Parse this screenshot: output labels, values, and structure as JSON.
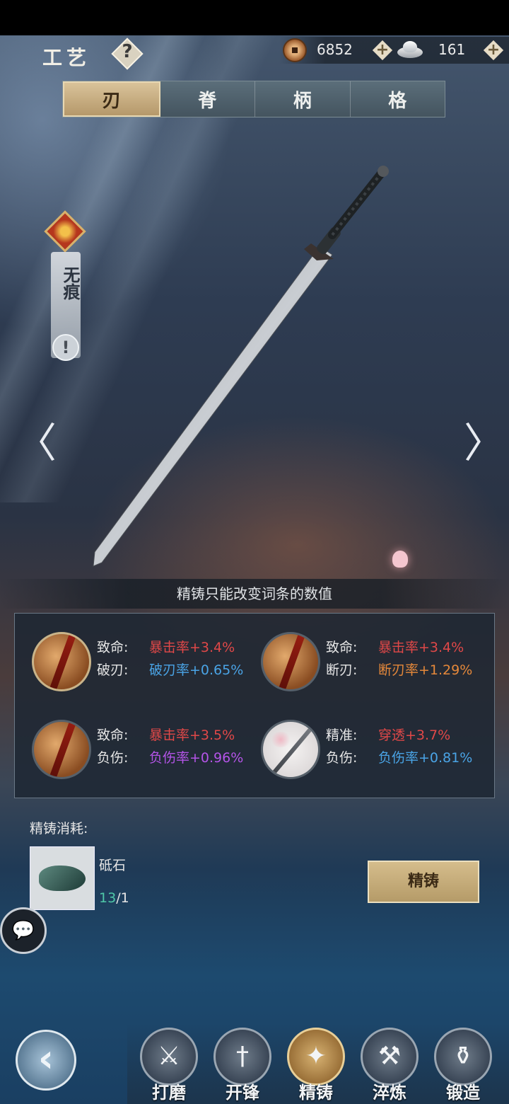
{
  "header": {
    "title": "工艺",
    "help_icon": "question-icon",
    "help_label": "?"
  },
  "resources": {
    "copper": {
      "icon": "copper-coin-icon",
      "value": "6852",
      "plus": "+"
    },
    "silver": {
      "icon": "silver-ingot-icon",
      "value": "161",
      "plus": "+"
    }
  },
  "tabs": [
    {
      "label": "刃",
      "active": true
    },
    {
      "label": "脊",
      "active": false
    },
    {
      "label": "柄",
      "active": false
    },
    {
      "label": "格",
      "active": false
    }
  ],
  "weapon": {
    "name": "无痕",
    "warn_label": "!",
    "prev_label": "〈",
    "next_label": "〉"
  },
  "notice": "精铸只能改变词条的数值",
  "stats": [
    {
      "rows": [
        {
          "label": "致命:",
          "value": "暴击率+3.4%",
          "color": "#e04848"
        },
        {
          "label": "破刃:",
          "value": "破刃率+0.65%",
          "color": "#4aa4e6"
        }
      ]
    },
    {
      "rows": [
        {
          "label": "致命:",
          "value": "暴击率+3.4%",
          "color": "#e04848"
        },
        {
          "label": "断刃:",
          "value": "断刃率+1.29%",
          "color": "#e5883a"
        }
      ]
    },
    {
      "rows": [
        {
          "label": "致命:",
          "value": "暴击率+3.5%",
          "color": "#e04848"
        },
        {
          "label": "负伤:",
          "value": "负伤率+0.96%",
          "color": "#b454e8"
        }
      ]
    },
    {
      "rows": [
        {
          "label": "精准:",
          "value": "穿透+3.7%",
          "color": "#e04848"
        },
        {
          "label": "负伤:",
          "value": "负伤率+0.81%",
          "color": "#4aa4e6"
        }
      ]
    }
  ],
  "cost": {
    "label": "精铸消耗:",
    "item_name": "砥石",
    "have": "13",
    "need": "/1"
  },
  "refine_button": "精铸",
  "chat_icon": "chat-bubble-icon",
  "back_icon": "back-arrow-icon",
  "nav": [
    {
      "label": "打磨",
      "icon": "grind-icon",
      "active": false
    },
    {
      "label": "开锋",
      "icon": "sharpen-icon",
      "active": false
    },
    {
      "label": "精铸",
      "icon": "refine-icon",
      "active": true
    },
    {
      "label": "淬炼",
      "icon": "temper-icon",
      "active": false
    },
    {
      "label": "锻造",
      "icon": "forge-icon",
      "active": false
    }
  ]
}
